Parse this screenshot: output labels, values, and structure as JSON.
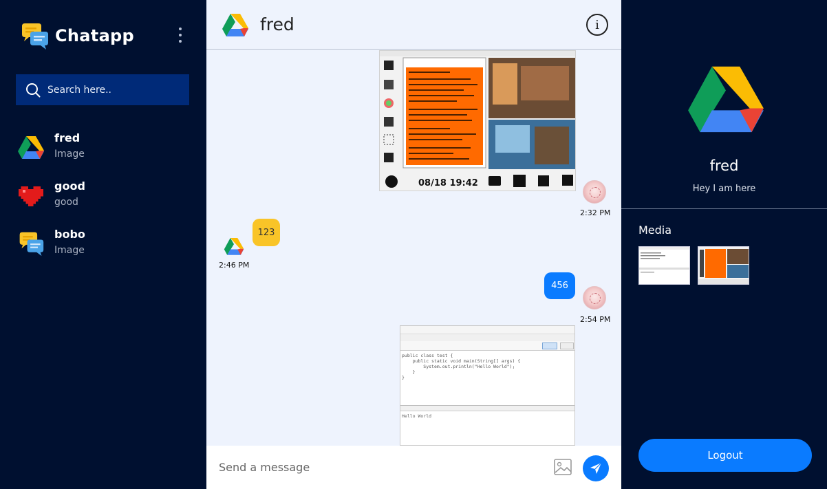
{
  "app": {
    "name": "Chatapp"
  },
  "search": {
    "placeholder": "Search here.."
  },
  "chats": [
    {
      "name": "fred",
      "subtitle": "Image",
      "avatar": "google-drive-icon"
    },
    {
      "name": "good",
      "subtitle": "good",
      "avatar": "pixel-heart-icon"
    },
    {
      "name": "bobo",
      "subtitle": "Image",
      "avatar": "chat-bubbles-icon"
    }
  ],
  "conversation": {
    "title": "fred",
    "messages": [
      {
        "type": "image",
        "from": "self",
        "time": "2:32 PM",
        "image_text": "08/18 19:42"
      },
      {
        "type": "text",
        "from": "other",
        "text": "123",
        "time": "2:46 PM"
      },
      {
        "type": "text",
        "from": "self",
        "text": "456",
        "time": "2:54 PM"
      },
      {
        "type": "image",
        "from": "self",
        "code_lines": [
          "public class test {",
          "    public static void main(String[] args) {",
          "        System.out.println(\"Hello World\");",
          "    }",
          "}"
        ],
        "output": "Hello World"
      }
    ]
  },
  "composer": {
    "placeholder": "Send a message"
  },
  "profile": {
    "name": "fred",
    "status": "Hey I am here"
  },
  "media": {
    "title": "Media"
  },
  "logout": {
    "label": "Logout"
  },
  "colors": {
    "background": "#001030",
    "accent": "#0a7bff",
    "bubble_incoming": "#f9c428",
    "search_bg": "#002a78"
  }
}
